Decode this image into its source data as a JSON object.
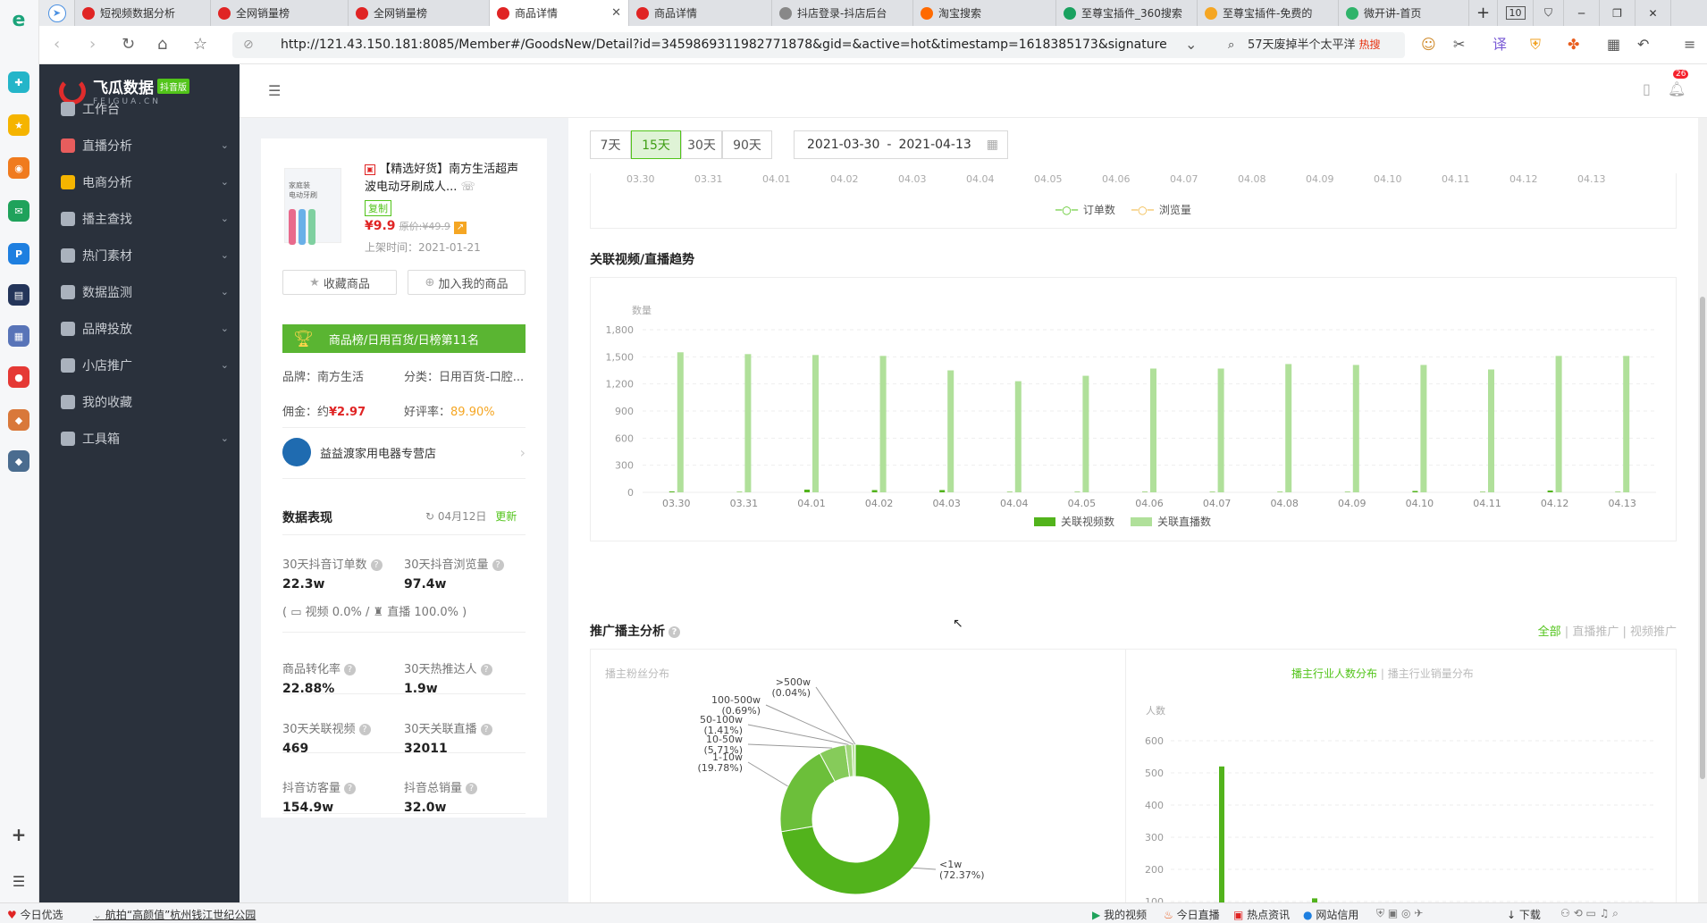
{
  "tabs": [
    {
      "label": "短视频数据分析",
      "color": "#e02424",
      "active": false
    },
    {
      "label": "全网销量榜",
      "color": "#e02424",
      "active": false
    },
    {
      "label": "全网销量榜",
      "color": "#e02424",
      "active": false
    },
    {
      "label": "商品详情",
      "color": "#e02424",
      "active": true
    },
    {
      "label": "商品详情",
      "color": "#e02424",
      "active": false
    },
    {
      "label": "抖店登录-抖店后台",
      "color": "#888",
      "active": false
    },
    {
      "label": "淘宝搜索",
      "color": "#ff6a00",
      "active": false
    },
    {
      "label": "至尊宝插件_360搜索",
      "color": "#19a15f",
      "active": false
    },
    {
      "label": "至尊宝插件-免费的",
      "color": "#f5a623",
      "active": false
    },
    {
      "label": "微开讲-首页",
      "color": "#2fb36a",
      "active": false
    }
  ],
  "tab_count": "10",
  "url": "http://121.43.150.181:8085/Member#/GoodsNew/Detail?id=3459869311982771878&gid=&active=hot&timestamp=1618385173&signature",
  "search": {
    "text": "57天废掉半个太平洋",
    "hot": "热搜"
  },
  "brand": {
    "name": "飞瓜数据",
    "sub": "FEIGUA.CN",
    "badge": "抖音版"
  },
  "nav": [
    {
      "label": "工作台",
      "caret": false
    },
    {
      "label": "直播分析",
      "caret": true
    },
    {
      "label": "电商分析",
      "caret": true
    },
    {
      "label": "播主查找",
      "caret": true
    },
    {
      "label": "热门素材",
      "caret": true
    },
    {
      "label": "数据监测",
      "caret": true
    },
    {
      "label": "品牌投放",
      "caret": true
    },
    {
      "label": "小店推广",
      "caret": true
    },
    {
      "label": "我的收藏",
      "caret": false
    },
    {
      "label": "工具箱",
      "caret": true
    }
  ],
  "header": {
    "notification_count": "26"
  },
  "product": {
    "tag": "【精选好货】",
    "title_rest": "南方生活超声波电动牙刷成人...",
    "copy": "复制",
    "price": "¥9.9",
    "original_label": "原价:",
    "original_price": "¥49.9",
    "listed_label": "上架时间：",
    "listed_date": "2021-01-21",
    "thumb_text": "家庭装\n电动牙刷",
    "collect": "收藏商品",
    "add_mine": "加入我的商品",
    "rank_banner": "商品榜/日用百货/日榜第11名",
    "brand_label": "品牌：",
    "brand": "南方生活",
    "category_label": "分类：",
    "category": "日用百货-口腔...",
    "commission_label": "佣金：约",
    "commission": "¥2.97",
    "rating_label": "好评率：",
    "rating": "89.90%",
    "shop": "益益渡家用电器专营店"
  },
  "performance": {
    "title": "数据表现",
    "date": "04月12日",
    "update": "更新",
    "metrics": [
      {
        "label": "30天抖音订单数",
        "value": "22.3w"
      },
      {
        "label": "30天抖音浏览量",
        "value": "97.4w"
      },
      {
        "label": "商品转化率",
        "value": "22.88%"
      },
      {
        "label": "30天热推达人",
        "value": "1.9w"
      },
      {
        "label": "30天关联视频",
        "value": "469"
      },
      {
        "label": "30天关联直播",
        "value": "32011"
      },
      {
        "label": "抖音访客量",
        "value": "154.9w"
      },
      {
        "label": "抖音总销量",
        "value": "32.0w"
      }
    ],
    "split": {
      "video": "视频 0.0% /",
      "live": "直播 100.0%"
    }
  },
  "range": {
    "buttons": [
      "7天",
      "15天",
      "30天",
      "90天"
    ],
    "selected": "15天",
    "start": "2021-03-30",
    "end": "2021-04-13",
    "sep": "-"
  },
  "top_chart": {
    "dates": [
      "03.30",
      "03.31",
      "04.01",
      "04.02",
      "04.03",
      "04.04",
      "04.05",
      "04.06",
      "04.07",
      "04.08",
      "04.09",
      "04.10",
      "04.11",
      "04.12",
      "04.13"
    ],
    "legend": [
      "订单数",
      "浏览量"
    ]
  },
  "trend": {
    "title": "关联视频/直播趋势",
    "ylabel": "数量"
  },
  "promo": {
    "title": "推广播主分析",
    "filters": [
      "全部",
      "直播推广",
      "视频推广"
    ],
    "left_sub": "播主粉丝分布",
    "right_tabs": [
      "播主行业人数分布",
      "播主行业销量分布"
    ],
    "right_ylabel": "人数"
  },
  "chart_data": [
    {
      "type": "bar",
      "title": "关联视频/直播趋势",
      "categories": [
        "03.30",
        "03.31",
        "04.01",
        "04.02",
        "04.03",
        "04.04",
        "04.05",
        "04.06",
        "04.07",
        "04.08",
        "04.09",
        "04.10",
        "04.11",
        "04.12",
        "04.13"
      ],
      "ylabel": "数量",
      "ylim": [
        0,
        1800
      ],
      "yticks": [
        0,
        300,
        600,
        900,
        1200,
        1500,
        1800
      ],
      "series": [
        {
          "name": "关联视频数",
          "color": "#52b31c",
          "values": [
            10,
            5,
            30,
            25,
            25,
            5,
            5,
            5,
            5,
            5,
            5,
            15,
            5,
            20,
            5
          ]
        },
        {
          "name": "关联直播数",
          "color": "#b0e09a",
          "values": [
            1550,
            1530,
            1520,
            1510,
            1350,
            1230,
            1290,
            1370,
            1370,
            1420,
            1410,
            1410,
            1360,
            1510,
            1510
          ]
        }
      ],
      "legend": "bottom"
    },
    {
      "type": "pie",
      "title": "播主粉丝分布",
      "labels": [
        "<1w",
        "1-10w",
        "10-50w",
        "50-100w",
        "100-500w",
        ">500w"
      ],
      "values": [
        72.37,
        19.78,
        5.71,
        1.41,
        0.69,
        0.04
      ],
      "display": [
        "(72.37%)",
        "(19.78%)",
        "(5.71%)",
        "(1.41%)",
        "(0.69%)",
        "(0.04%)"
      ],
      "colors": [
        "#52b31c",
        "#6cbf3a",
        "#86cb5a",
        "#a0d67b",
        "#b9e29c",
        "#d3edbd"
      ]
    },
    {
      "type": "bar",
      "title": "播主行业人数分布",
      "ylabel": "人数",
      "ylim": [
        100,
        600
      ],
      "yticks": [
        100,
        200,
        300,
        400,
        500,
        600
      ],
      "values": [
        520,
        110
      ],
      "color": "#52b31c"
    }
  ],
  "statusbar": {
    "left1": "今日优选",
    "left2": "航拍“高颜值”杭州钱江世纪公园",
    "right": [
      "我的视频",
      "今日直播",
      "热点资讯",
      "网站信用",
      "下载"
    ]
  }
}
